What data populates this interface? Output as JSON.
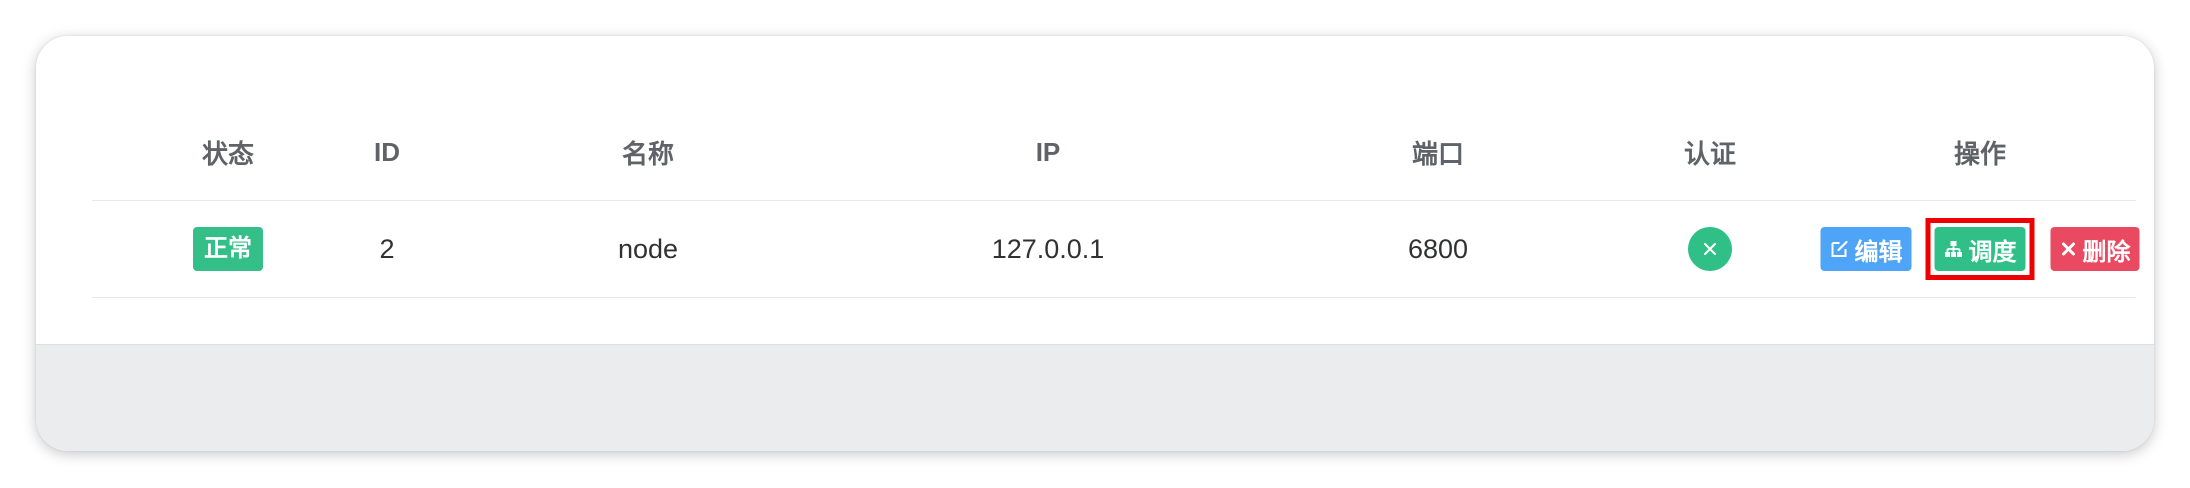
{
  "table": {
    "columns": [
      "状态",
      "ID",
      "名称",
      "IP",
      "端口",
      "认证",
      "操作"
    ],
    "rows": [
      {
        "status": "正常",
        "id": "2",
        "name": "node",
        "ip": "127.0.0.1",
        "port": "6800",
        "auth_icon": "close-icon",
        "actions": {
          "edit": "编辑",
          "schedule": "调度",
          "delete": "删除"
        }
      }
    ]
  },
  "colors": {
    "status_ok": "#34bf89",
    "auth": "#2fbf87",
    "edit": "#4ea4f6",
    "schedule": "#2fbf87",
    "delete": "#ea4a61",
    "highlight": "#ee0000"
  }
}
